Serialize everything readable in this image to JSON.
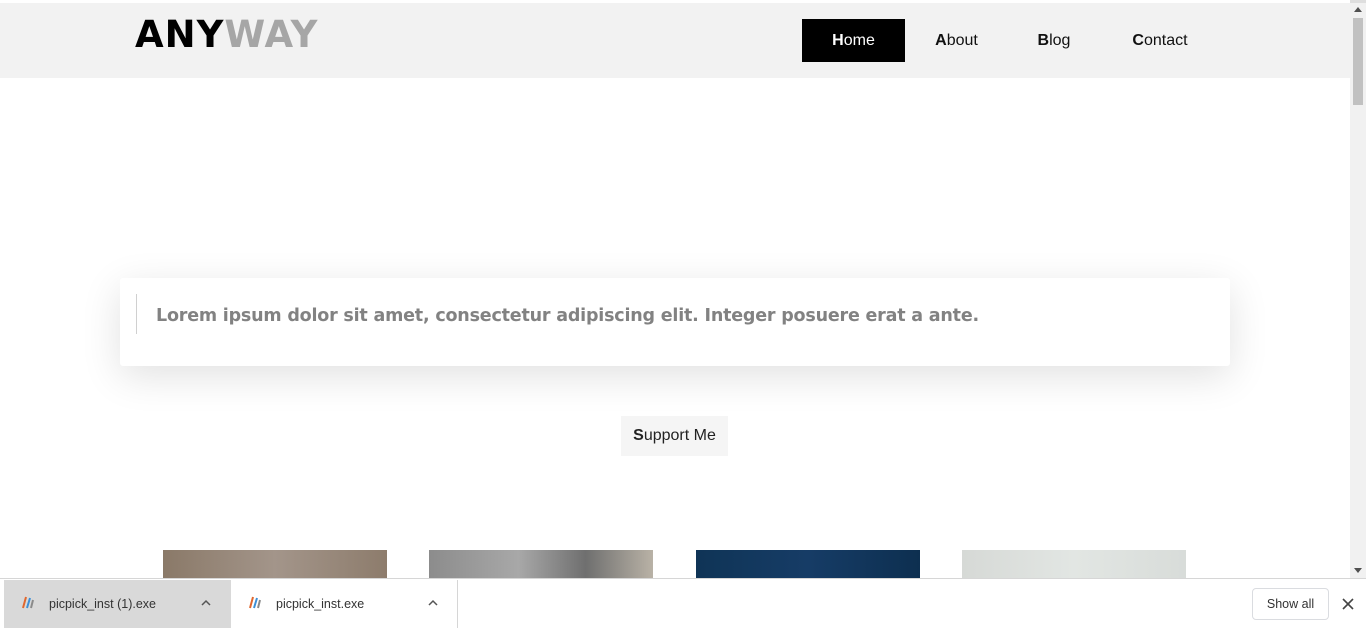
{
  "header": {
    "logo_part1": "ANY",
    "logo_part2": "WAY",
    "nav": [
      {
        "cap": "H",
        "rest": "ome"
      },
      {
        "cap": "A",
        "rest": "bout"
      },
      {
        "cap": "B",
        "rest": "log"
      },
      {
        "cap": "C",
        "rest": "ontact"
      }
    ],
    "active_index": 0
  },
  "quote": {
    "text": "Lorem ipsum dolor sit amet, consectetur adipiscing elit. Integer posuere erat a ante."
  },
  "support_button": {
    "cap": "S",
    "rest": "upport Me"
  },
  "download_bar": {
    "items": [
      {
        "name": "picpick_inst (1).exe",
        "icon": "picpick-file-icon"
      },
      {
        "name": "picpick_inst.exe",
        "icon": "picpick-file-icon"
      }
    ],
    "show_all_label": "Show all"
  },
  "colors": {
    "header_bg": "#f2f2f2",
    "logo_dark": "#000000",
    "logo_light": "#a6a6a6",
    "nav_active_bg": "#000000",
    "quote_text": "#828282"
  }
}
